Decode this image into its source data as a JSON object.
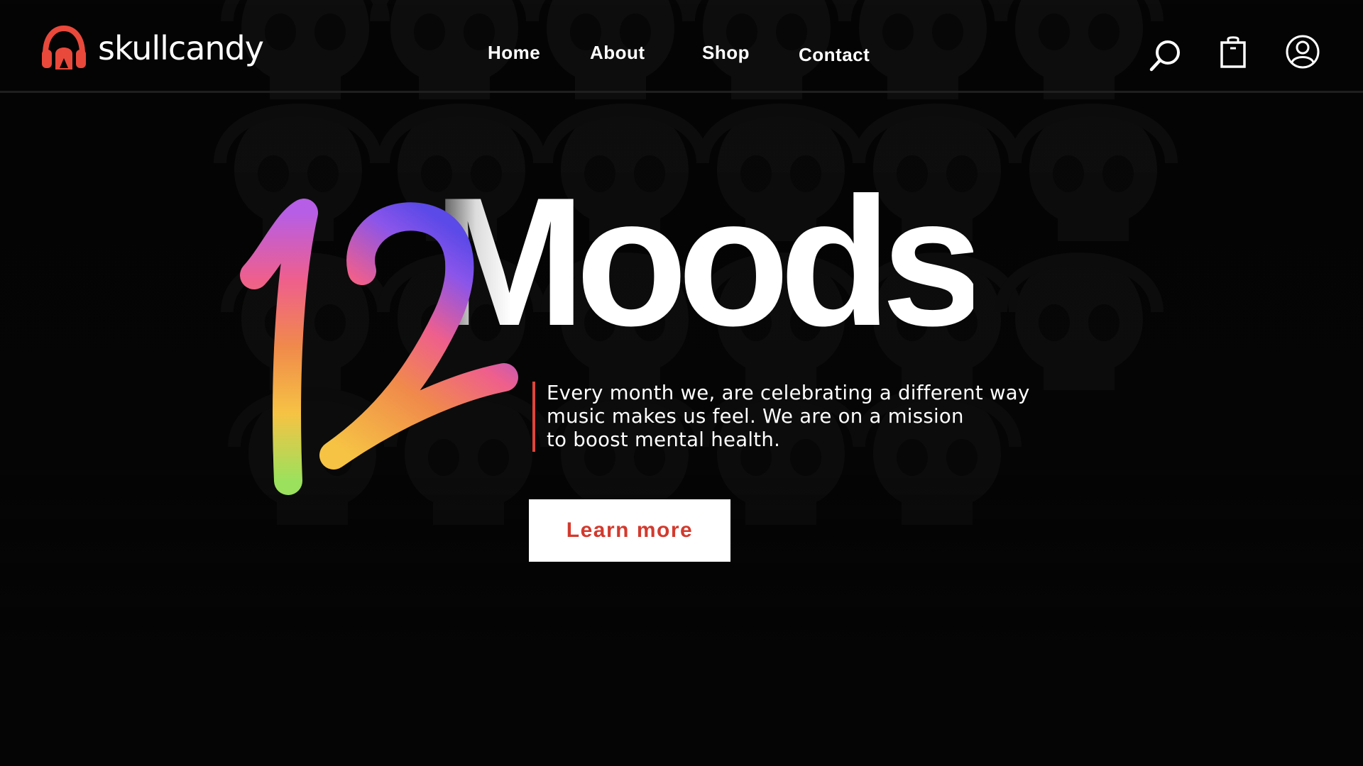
{
  "brand": {
    "name": "skullcandy",
    "logo_icon": "headphone-skull-icon",
    "accent_color": "#e9493b"
  },
  "nav": {
    "items": [
      {
        "label": "Home"
      },
      {
        "label": "About"
      },
      {
        "label": "Shop"
      },
      {
        "label": "Contact"
      }
    ]
  },
  "header_icons": {
    "search": "search-icon",
    "cart": "shopping-bag-icon",
    "account": "user-account-icon"
  },
  "hero": {
    "number": "12",
    "title": "Moods",
    "description_lines": [
      "Every month we, are celebrating a different way",
      "music makes us feel. We are on a mission",
      "to boost mental health."
    ],
    "cta_label": "Learn more",
    "cta_color": "#d23a2e",
    "rule_color": "#e0453a"
  },
  "colors": {
    "background": "#050505",
    "text": "#ffffff",
    "gradient_stops": [
      "#9be15d",
      "#f6c344",
      "#f08a4b",
      "#ef5f8c",
      "#b65ee6",
      "#5b49e8"
    ]
  }
}
